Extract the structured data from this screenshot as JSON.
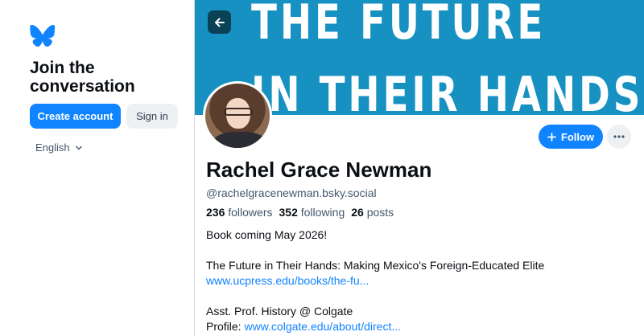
{
  "sidebar": {
    "logo_icon": "butterfly-icon",
    "join_title": "Join the conversation",
    "create_account_label": "Create account",
    "sign_in_label": "Sign in",
    "language_label": "English",
    "language_icon": "chevron-down-icon"
  },
  "profile": {
    "banner_text_line1": "THE FUTURE",
    "banner_text_line2": "IN THEIR HANDS",
    "back_icon": "arrow-left-icon",
    "follow_label": "Follow",
    "more_icon": "ellipsis-icon",
    "name": "Rachel Grace Newman",
    "handle": "@rachelgracenewman.bsky.social",
    "stats": {
      "followers_count": "236",
      "followers_label": "followers",
      "following_count": "352",
      "following_label": "following",
      "posts_count": "26",
      "posts_label": "posts"
    },
    "bio": {
      "line1": "Book coming May 2026!",
      "line2": "The Future in Their Hands: Making Mexico's Foreign-Educated Elite",
      "link1": "www.ucpress.edu/books/the-fu...",
      "line3": "Asst. Prof. History @ Colgate",
      "line4_prefix": "Profile: ",
      "link2": "www.colgate.edu/about/direct..."
    }
  },
  "colors": {
    "accent": "#1083fe",
    "banner": "#1791c2",
    "muted_text": "#42576c"
  }
}
